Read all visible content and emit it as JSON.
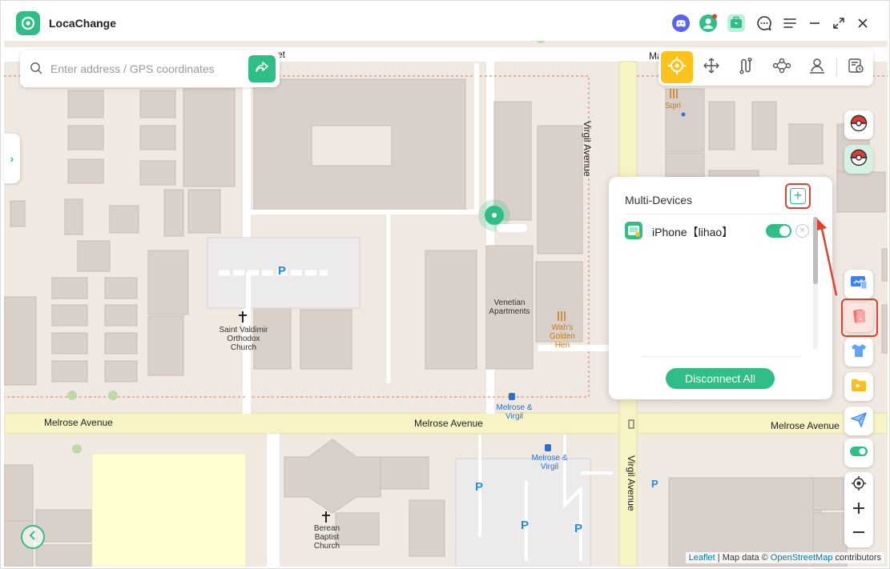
{
  "app": {
    "title": "LocaChange"
  },
  "search": {
    "placeholder": "Enter address / GPS coordinates"
  },
  "map_labels": {
    "melrose_avenue": "Melrose Avenue",
    "virgil_avenue": "Virgil Avenue",
    "street_top": "et",
    "street_top_right": "Ma",
    "saint_valdimir": "Saint Valdimir Orthodox Church",
    "venetian": "Venetian Apartments",
    "wahs": "Wah's Golden Hen",
    "sqirl": "Sqirl",
    "melrose_virgil": "Melrose & Virgil",
    "berean": "Berean Baptist Church",
    "parking": "P"
  },
  "panel": {
    "title": "Multi-Devices",
    "device_name": "iPhone【lihao】",
    "disconnect_label": "Disconnect All"
  },
  "attribution": {
    "leaflet": "Leaflet",
    "map_data": "| Map data ©",
    "osm": "OpenStreetMap",
    "contributors": "contributors"
  },
  "colors": {
    "accent": "#2fbf86",
    "mode_active": "#ffc21a",
    "annotation": "#e0402e",
    "map_bg": "#efe9e1",
    "road": "#f7f3c4"
  },
  "icons": {
    "search": "search-icon",
    "go": "share-arrow-icon",
    "teleport": "crosshair-icon",
    "joystick": "move-arrows-icon",
    "two_spot": "route-icon",
    "multi_spot": "multi-stop-icon",
    "jump": "person-pin-icon",
    "history": "history-icon"
  }
}
